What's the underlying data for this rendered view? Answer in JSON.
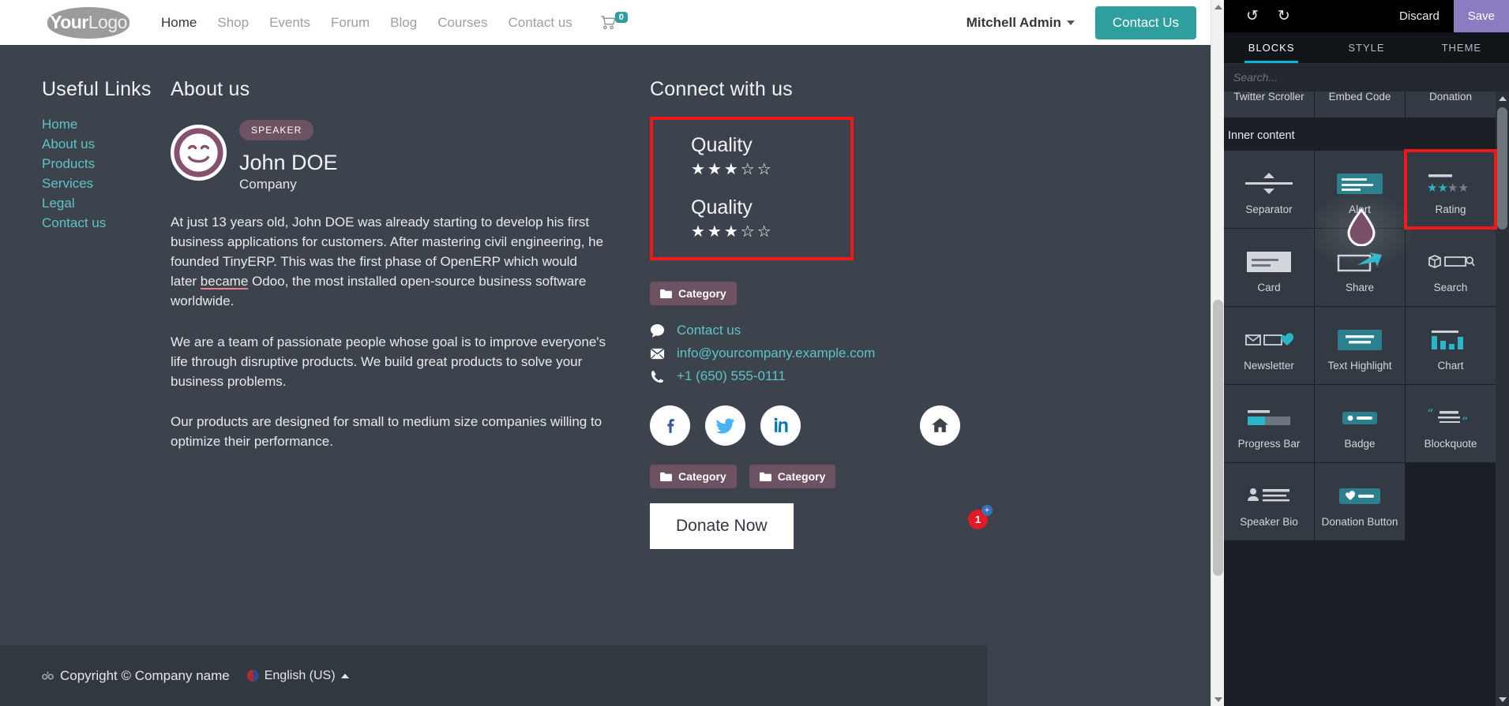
{
  "navbar": {
    "logo_bold": "Your",
    "logo_light": "Logo",
    "links": [
      {
        "label": "Home",
        "active": true
      },
      {
        "label": "Shop",
        "active": false
      },
      {
        "label": "Events",
        "active": false
      },
      {
        "label": "Forum",
        "active": false
      },
      {
        "label": "Blog",
        "active": false
      },
      {
        "label": "Courses",
        "active": false
      },
      {
        "label": "Contact us",
        "active": false
      }
    ],
    "cart_count": "0",
    "user_name": "Mitchell Admin",
    "contact_button": "Contact Us"
  },
  "footer": {
    "useful_links": {
      "title": "Useful Links",
      "items": [
        "Home",
        "About us",
        "Products",
        "Services",
        "Legal",
        "Contact us"
      ]
    },
    "about": {
      "title": "About us",
      "badge": "SPEAKER",
      "name": "John DOE",
      "company": "Company",
      "bio_1_a": "At just 13 years old, John DOE was already starting to develop his first business applications for customers. After mastering civil engineering, he founded TinyERP. This was the first phase of OpenERP which would later ",
      "bio_1_misspelled": "became",
      "bio_1_b": " Odoo, the most installed open-source business software worldwide.",
      "bio_2": "We are a team of passionate people whose goal is to improve everyone's life through disruptive products. We build great products to solve your business problems.",
      "bio_3": "Our products are designed for small to medium size companies willing to optimize their performance."
    },
    "connect": {
      "title": "Connect with us",
      "ratings": [
        {
          "label": "Quality",
          "value": 3,
          "max": 5
        },
        {
          "label": "Quality",
          "value": 3,
          "max": 5
        }
      ],
      "category_badge": "Category",
      "contacts": [
        {
          "icon": "comment-icon",
          "label": "Contact us"
        },
        {
          "icon": "envelope-icon",
          "label": "info@yourcompany.example.com"
        },
        {
          "icon": "phone-icon",
          "label": "+1 (650) 555-0111"
        }
      ],
      "socials": [
        "facebook-icon",
        "twitter-icon",
        "linkedin-icon",
        "home-icon"
      ],
      "categories": [
        "Category",
        "Category"
      ],
      "donate_button": "Donate Now"
    },
    "bottom": {
      "copyright": "Copyright © Company name",
      "language": "English (US)"
    },
    "error_count": "1"
  },
  "panel": {
    "undo_icon": "undo-icon",
    "redo_icon": "redo-icon",
    "discard": "Discard",
    "save": "Save",
    "tabs": [
      {
        "label": "BLOCKS",
        "active": true
      },
      {
        "label": "STYLE",
        "active": false
      },
      {
        "label": "THEME",
        "active": false
      }
    ],
    "search_placeholder": "Search...",
    "partial_row": [
      "Twitter Scroller",
      "Embed Code",
      "Donation"
    ],
    "section_title": "Inner content",
    "blocks": [
      {
        "label": "Separator",
        "icon": "separator-icon",
        "selected": false
      },
      {
        "label": "Alert",
        "icon": "alert-icon",
        "selected": false
      },
      {
        "label": "Rating",
        "icon": "rating-icon",
        "selected": true
      },
      {
        "label": "Card",
        "icon": "card-icon",
        "selected": false
      },
      {
        "label": "Share",
        "icon": "share-icon",
        "selected": false
      },
      {
        "label": "Search",
        "icon": "search-block-icon",
        "selected": false
      },
      {
        "label": "Newsletter",
        "icon": "newsletter-icon",
        "selected": false
      },
      {
        "label": "Text Highlight",
        "icon": "text-highlight-icon",
        "selected": false
      },
      {
        "label": "Chart",
        "icon": "chart-icon",
        "selected": false
      },
      {
        "label": "Progress Bar",
        "icon": "progress-bar-icon",
        "selected": false
      },
      {
        "label": "Badge",
        "icon": "badge-icon",
        "selected": false
      },
      {
        "label": "Blockquote",
        "icon": "blockquote-icon",
        "selected": false
      },
      {
        "label": "Speaker Bio",
        "icon": "speaker-bio-icon",
        "selected": false
      },
      {
        "label": "Donation Button",
        "icon": "donation-button-icon",
        "selected": false
      }
    ]
  },
  "colors": {
    "accent_teal": "#2f9e9e",
    "link_teal": "#5ec4c4",
    "badge_plum": "#6d5261",
    "highlight_red": "#f01818",
    "save_purple": "#8e7cc3",
    "panel_tab_underline": "#00b5d1"
  }
}
